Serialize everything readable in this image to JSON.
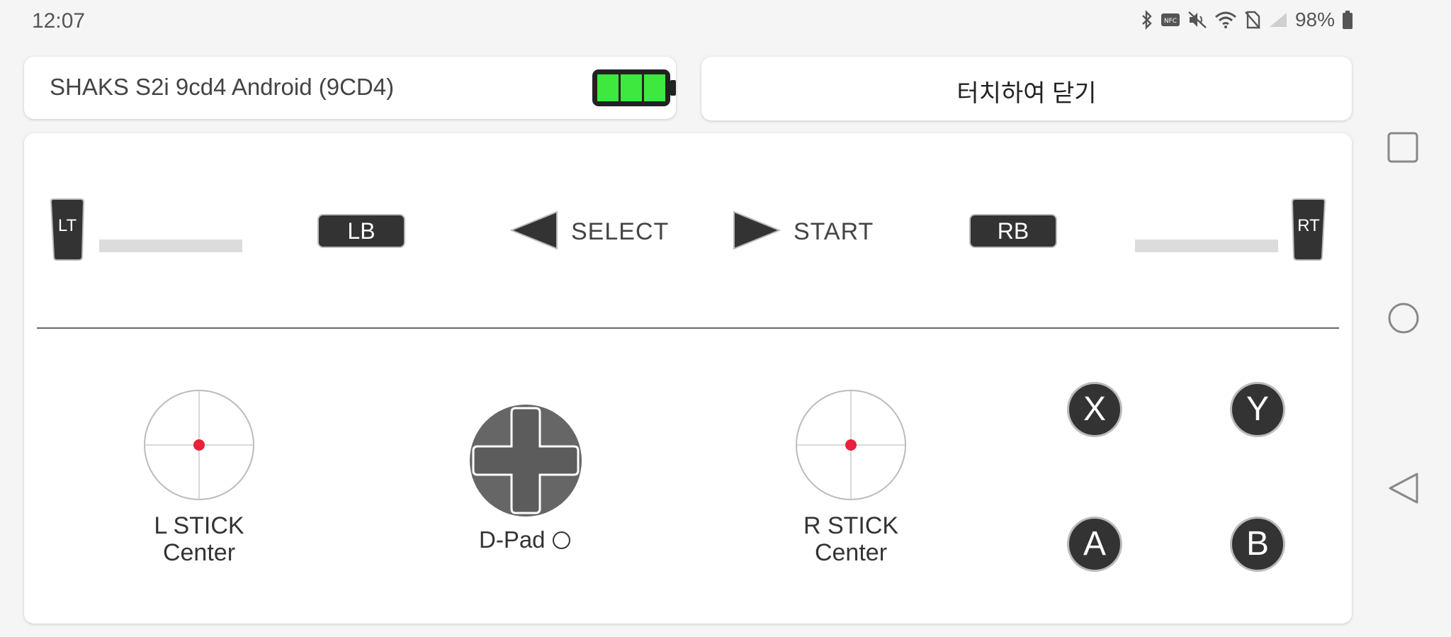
{
  "status_bar": {
    "time": "12:07",
    "battery_percent": "98%",
    "icons": [
      "bluetooth-icon",
      "nfc-icon",
      "mute-icon",
      "wifi-icon",
      "no-sim-icon",
      "signal-icon",
      "battery-icon"
    ]
  },
  "device": {
    "name": "SHAKS S2i 9cd4 Android (9CD4)",
    "battery_level_bars": 3,
    "battery_color": "#3ee83e"
  },
  "close_button": {
    "label": "터치하여 닫기"
  },
  "controls": {
    "lt_label": "LT",
    "rt_label": "RT",
    "lt_value": 0,
    "rt_value": 0,
    "lb_label": "LB",
    "rb_label": "RB",
    "select_label": "SELECT",
    "start_label": "START"
  },
  "sticks": {
    "left": {
      "line1": "L STICK",
      "line2": "Center"
    },
    "right": {
      "line1": "R STICK",
      "line2": "Center"
    },
    "dot_color": "#e8203a"
  },
  "dpad": {
    "label": "D-Pad"
  },
  "face_buttons": {
    "x": "X",
    "y": "Y",
    "a": "A",
    "b": "B"
  },
  "nav": [
    "recents-icon",
    "home-icon",
    "back-icon"
  ]
}
